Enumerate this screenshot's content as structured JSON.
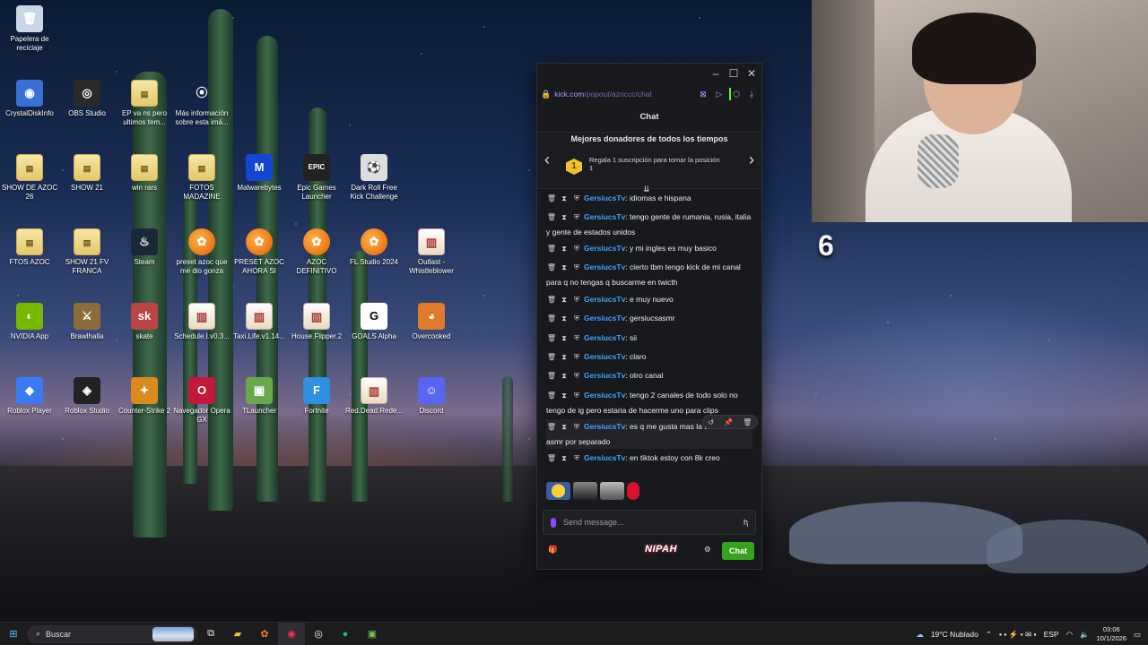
{
  "desktop_icons": [
    {
      "label": "Papelera de reciclaje",
      "icon": "recycle-bin-icon",
      "glyph": "🗑"
    },
    {
      "label": "CrystalDiskInfo",
      "icon": "crystaldiskinfo-icon",
      "glyph": "◉"
    },
    {
      "label": "OBS Studio",
      "icon": "obs-icon",
      "glyph": "◎"
    },
    {
      "label": "EP va ns pero ultimos tem...",
      "icon": "folder-icon",
      "glyph": "▤"
    },
    {
      "label": "Más información sobre esta imá...",
      "icon": "info-camera-icon",
      "glyph": "⦿"
    },
    {
      "label": "SHOW DE AZOC 26",
      "icon": "folder-icon",
      "glyph": "▤"
    },
    {
      "label": "SHOW 21",
      "icon": "folder-icon",
      "glyph": "▤"
    },
    {
      "label": "win rars",
      "icon": "folder-icon",
      "glyph": "▤"
    },
    {
      "label": "FOTOS MADAZINE",
      "icon": "folder-icon",
      "glyph": "▤"
    },
    {
      "label": "Malwarebytes",
      "icon": "malwarebytes-icon",
      "glyph": "M"
    },
    {
      "label": "Epic Games Launcher",
      "icon": "epic-games-icon",
      "glyph": "EPIC"
    },
    {
      "label": "Dark Roll Free Kick Challenge",
      "icon": "soccer-ball-icon",
      "glyph": "⚽"
    },
    {
      "label": "FTOS AZOC",
      "icon": "folder-icon",
      "glyph": "▤"
    },
    {
      "label": "SHOW 21 FV FRANCA",
      "icon": "folder-icon",
      "glyph": "▤"
    },
    {
      "label": "Steam",
      "icon": "steam-icon",
      "glyph": "♨"
    },
    {
      "label": "preset azoc que me dio gonza",
      "icon": "fl-studio-icon",
      "glyph": "✿"
    },
    {
      "label": "PRESET AZOC AHORA SI",
      "icon": "fl-studio-icon",
      "glyph": "✿"
    },
    {
      "label": "AZOC DEFINITIVO",
      "icon": "fl-studio-icon",
      "glyph": "✿"
    },
    {
      "label": "FL Studio 2024",
      "icon": "fl-studio-icon",
      "glyph": "✿"
    },
    {
      "label": "Outlast - Whistleblower",
      "icon": "rar-icon",
      "glyph": "▥"
    },
    {
      "label": "NVIDIA App",
      "icon": "nvidia-icon",
      "glyph": "◐"
    },
    {
      "label": "Brawlhalla",
      "icon": "brawlhalla-icon",
      "glyph": "⚔"
    },
    {
      "label": "skate",
      "icon": "skate-icon",
      "glyph": "sk"
    },
    {
      "label": "Schedule.I.v0.3...",
      "icon": "rar-icon",
      "glyph": "▥"
    },
    {
      "label": "Taxi.Life.v1.14...",
      "icon": "rar-icon",
      "glyph": "▥"
    },
    {
      "label": "House.Flipper.2",
      "icon": "rar-icon",
      "glyph": "▥"
    },
    {
      "label": "GOALS Alpha",
      "icon": "goals-icon",
      "glyph": "G"
    },
    {
      "label": "Overcooked",
      "icon": "overcooked-icon",
      "glyph": "◕"
    },
    {
      "label": "Roblox Player",
      "icon": "roblox-player-icon",
      "glyph": "◆"
    },
    {
      "label": "Roblox Studio",
      "icon": "roblox-studio-icon",
      "glyph": "◈"
    },
    {
      "label": "Counter-Strike 2",
      "icon": "counter-strike-icon",
      "glyph": "✦"
    },
    {
      "label": "Navegador Opera GX",
      "icon": "opera-gx-icon",
      "glyph": "O"
    },
    {
      "label": "TLauncher",
      "icon": "tlauncher-icon",
      "glyph": "▣"
    },
    {
      "label": "Fortnite",
      "icon": "fortnite-icon",
      "glyph": "F"
    },
    {
      "label": "Red.Dead.Rede...",
      "icon": "rar-icon",
      "glyph": "▥"
    },
    {
      "label": "Discord",
      "icon": "discord-icon",
      "glyph": "☺"
    }
  ],
  "chat_window": {
    "url": "kick.com/popout/azoccc/chat",
    "url_prefix": "kick.com",
    "url_rest": "/popout/azoccc/chat",
    "title": "Chat",
    "donors_heading": "Mejores donadores de todos los tiempos",
    "rank": "1",
    "gift_text": "Regala 1 suscripción para tomar la posición 1",
    "messages": [
      {
        "user": "GersiucsTv",
        "text": "idiomas e hispana"
      },
      {
        "user": "GersiucsTv",
        "text": "tengo gente de rumania, rusia, italia y gente de estados unidos"
      },
      {
        "user": "GersiucsTv",
        "text": "y mi ingles es muy basico"
      },
      {
        "user": "GersiucsTv",
        "text": "cierto tbm tengo kick de mi canal para q no tengas q buscarme en twicth"
      },
      {
        "user": "GersiucsTv",
        "text": "e muy nuevo"
      },
      {
        "user": "GersiucsTv",
        "text": "gersiucsasmr"
      },
      {
        "user": "GersiucsTv",
        "text": "sii"
      },
      {
        "user": "GersiucsTv",
        "text": "claro"
      },
      {
        "user": "GersiucsTv",
        "text": "otro canal"
      },
      {
        "user": "GersiucsTv",
        "text": "tengo 2 canales de todo solo no tengo de ig pero estaria de hacerme uno para clips"
      },
      {
        "user": "GersiucsTv",
        "text": "es q me gusta mas la tematica de asmr por separado"
      },
      {
        "user": "GersiucsTv",
        "text": "en tiktok estoy con 8k creo"
      }
    ],
    "send_placeholder": "Send message...",
    "nipah_label": "NIPAH",
    "chat_button": "Chat"
  },
  "overlay_number": "6",
  "taskbar": {
    "search_label": "Buscar",
    "weather": "19°C Nublado",
    "language": "ESP",
    "time": "03:06",
    "date": "10/1/2026"
  }
}
